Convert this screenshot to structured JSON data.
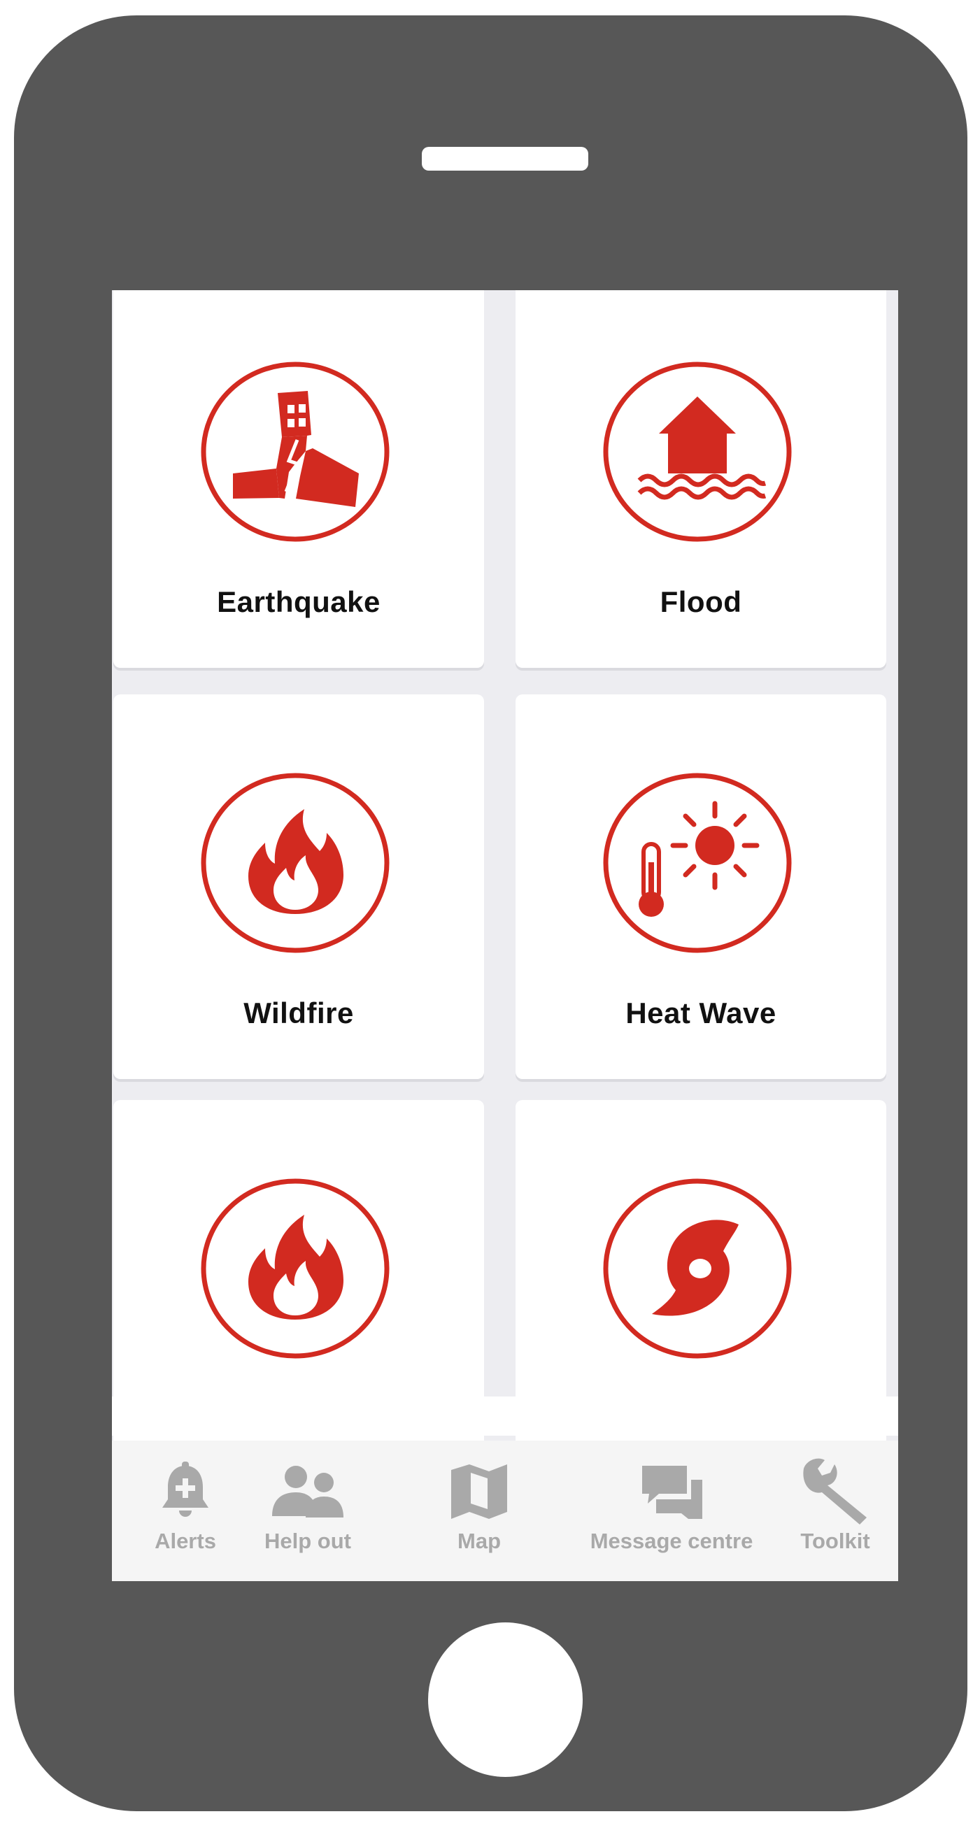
{
  "accent_color": "#d22a20",
  "hazards": [
    {
      "label": "Earthquake",
      "icon": "earthquake-icon"
    },
    {
      "label": "Flood",
      "icon": "flood-icon"
    },
    {
      "label": "Wildfire",
      "icon": "wildfire-icon"
    },
    {
      "label": "Heat Wave",
      "icon": "heat-wave-icon"
    },
    {
      "label": "",
      "icon": "fire-icon"
    },
    {
      "label": "",
      "icon": "hurricane-icon"
    }
  ],
  "tabbar": {
    "items": [
      {
        "label": "Alerts",
        "icon": "bell-plus-icon"
      },
      {
        "label": "Help out",
        "icon": "people-icon"
      },
      {
        "label": "Map",
        "icon": "map-icon"
      },
      {
        "label": "Message centre",
        "icon": "chat-bubbles-icon"
      },
      {
        "label": "Toolkit",
        "icon": "wrench-icon"
      }
    ]
  }
}
